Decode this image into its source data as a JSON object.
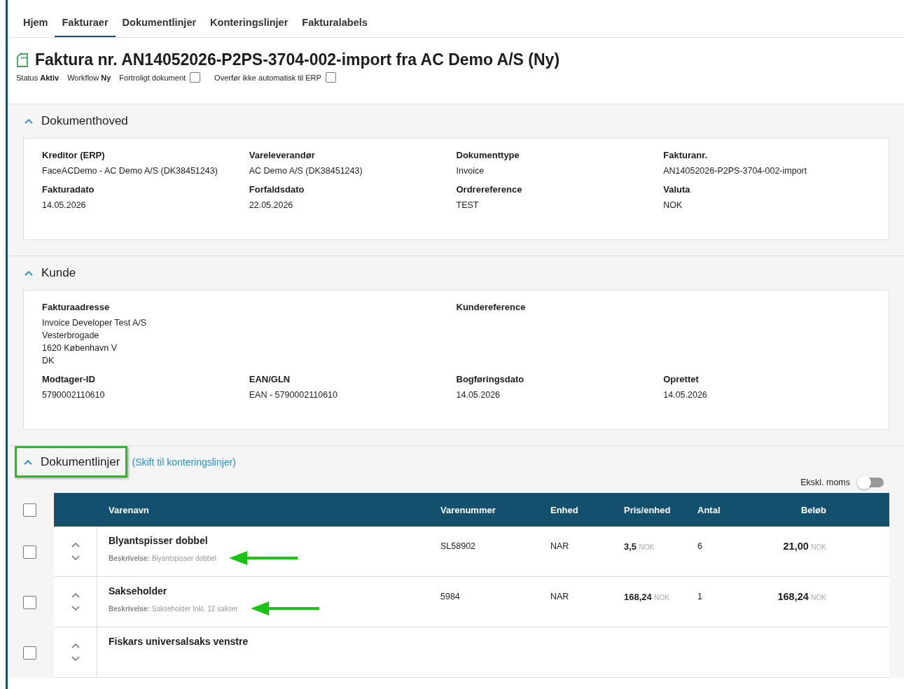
{
  "tabs": [
    {
      "label": "Hjem",
      "selected": false
    },
    {
      "label": "Fakturaer",
      "selected": true
    },
    {
      "label": "Dokumentlinjer",
      "selected": false
    },
    {
      "label": "Konteringslinjer",
      "selected": false
    },
    {
      "label": "Fakturalabels",
      "selected": false
    }
  ],
  "title": "Faktura nr. AN14052026-P2PS-3704-002-import fra AC Demo A/S (Ny)",
  "meta": [
    {
      "kind": "text",
      "label": "Status",
      "value": "Aktiv"
    },
    {
      "kind": "text",
      "label": "Workflow",
      "value": "Ny"
    },
    {
      "kind": "checkbox",
      "label": "Fortroligt dokument",
      "checked": false
    },
    {
      "kind": "checkbox",
      "label": "Overfør ikke automatisk til ERP",
      "checked": false
    }
  ],
  "sections": [
    {
      "title": "Dokumenthoved",
      "expanded": true,
      "fields": [
        {
          "kind": "field",
          "label": "Kreditor (ERP)",
          "lines": [
            "FaceACDemo - AC Demo A/S (DK38451243)"
          ]
        },
        {
          "kind": "field",
          "label": "Vareleverandør",
          "lines": [
            "AC Demo A/S (DK38451243)"
          ]
        },
        {
          "kind": "field",
          "label": "Dokumenttype",
          "lines": [
            "Invoice"
          ]
        },
        {
          "kind": "field",
          "label": "Fakturanr.",
          "lines": [
            "AN14052026-P2PS-3704-002-import"
          ]
        },
        {
          "kind": "field",
          "label": "Fakturadato",
          "lines": [
            "14.05.2026"
          ]
        },
        {
          "kind": "field",
          "label": "Forfaldsdato",
          "lines": [
            "22.05.2026"
          ]
        },
        {
          "kind": "field",
          "label": "Ordrereference",
          "lines": [
            "TEST"
          ]
        },
        {
          "kind": "field",
          "label": "Valuta",
          "lines": [
            "NOK"
          ]
        }
      ]
    },
    {
      "title": "Kunde",
      "expanded": true,
      "fields": [
        {
          "kind": "address",
          "label": "Fakturaadresse",
          "lines": [
            "Invoice Developer Test A/S",
            "Vesterbrogade",
            "1620 København V",
            "DK"
          ]
        },
        {
          "kind": "wide",
          "label": "Kundereference"
        },
        {
          "kind": "field",
          "label": "Modtager-ID",
          "lines": [
            "5790002110610"
          ]
        },
        {
          "kind": "field",
          "label": "EAN/GLN",
          "lines": [
            "EAN - 5790002110610"
          ]
        },
        {
          "kind": "field",
          "label": "Bogføringsdato",
          "lines": [
            "14.05.2026"
          ]
        },
        {
          "kind": "field",
          "label": "Oprettet",
          "lines": [
            "14.05.2026"
          ]
        }
      ]
    }
  ],
  "lines": {
    "title": "Dokumentlinjer",
    "expanded": true,
    "highlighted": true,
    "link": "(Skift til konteringslinjer)",
    "toggle": {
      "label": "Ekskl. moms",
      "on": false
    },
    "select_all": {
      "checked": false
    },
    "columns": [
      "Varenavn",
      "Varenummer",
      "Enhed",
      "Pris/enhed",
      "Antal",
      "Beløb"
    ],
    "rows": [
      {
        "checked": false,
        "arrow": true,
        "name": "Blyantspisser dobbel",
        "description_label": "Beskrivelse:",
        "description": "Blyantspisser dobbel",
        "number": "SL58902",
        "unit": "NAR",
        "price": "3,5",
        "price_currency": "NOK",
        "qty": "6",
        "amount": "21,00",
        "amount_currency": "NOK"
      },
      {
        "checked": false,
        "arrow": true,
        "name": "Sakseholder",
        "description_label": "Beskrivelse:",
        "description": "Sakseholder Inkl. 12 sakser",
        "number": "5984",
        "unit": "NAR",
        "price": "168,24",
        "price_currency": "NOK",
        "qty": "1",
        "amount": "168,24",
        "amount_currency": "NOK"
      },
      {
        "checked": false,
        "arrow": false,
        "name": "Fiskars universalsaks venstre"
      }
    ]
  }
}
